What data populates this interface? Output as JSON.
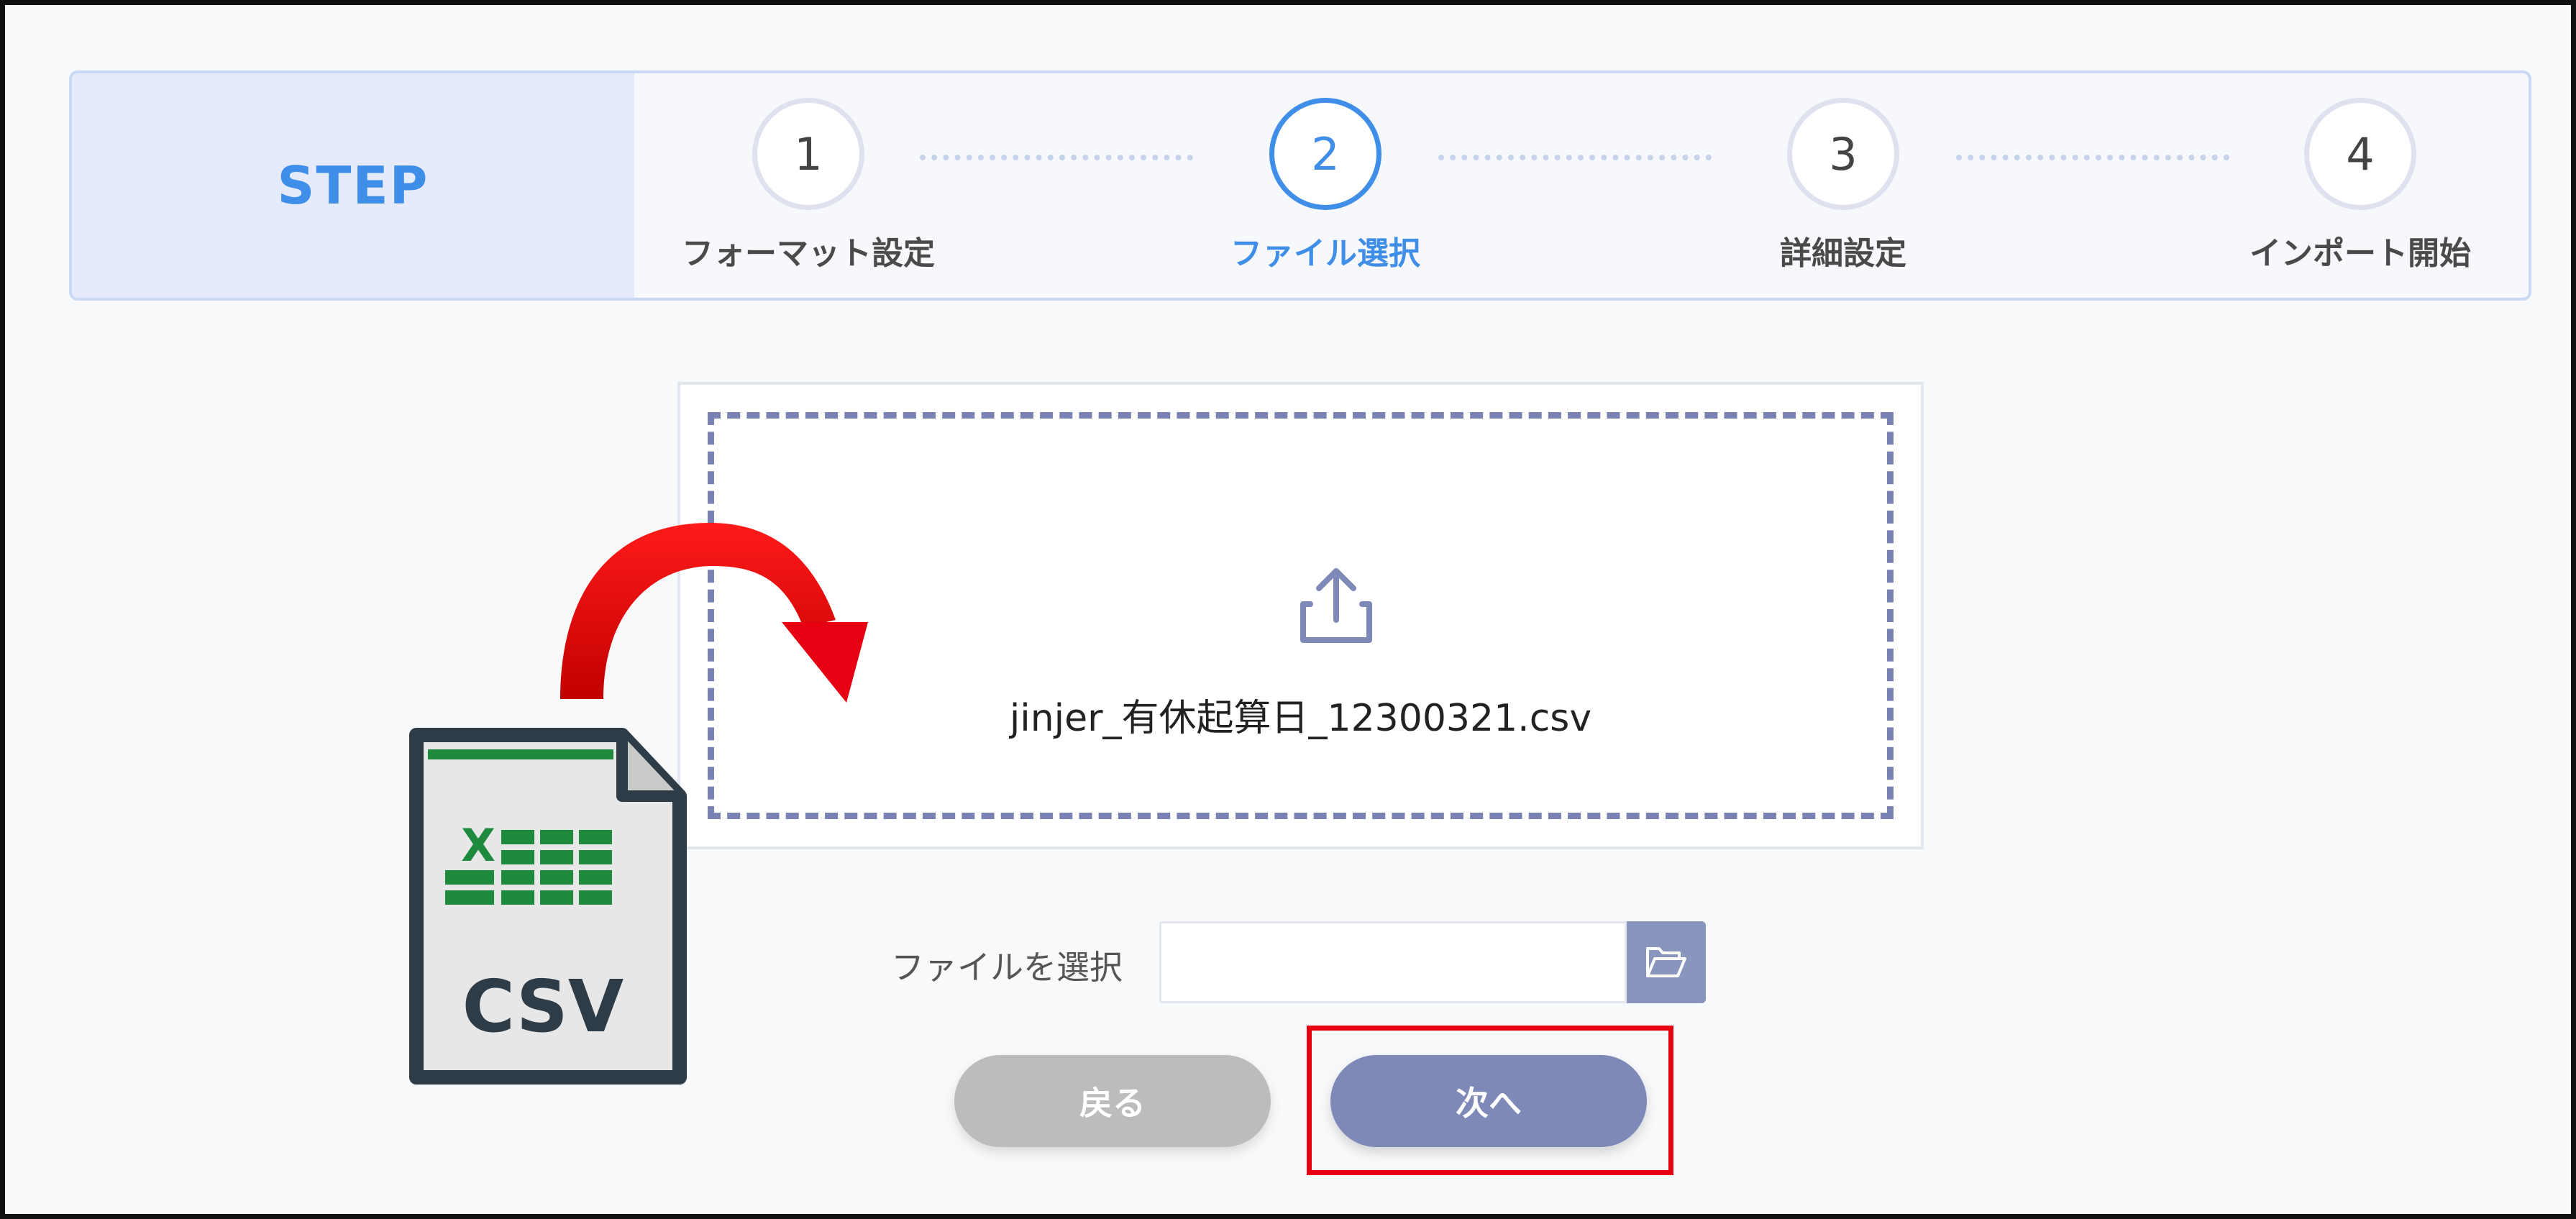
{
  "stepper": {
    "title": "STEP",
    "steps": [
      {
        "number": "1",
        "label": "フォーマット設定",
        "active": false
      },
      {
        "number": "2",
        "label": "ファイル選択",
        "active": true
      },
      {
        "number": "3",
        "label": "詳細設定",
        "active": false
      },
      {
        "number": "4",
        "label": "インポート開始",
        "active": false
      }
    ]
  },
  "dropzone": {
    "icon": "upload-icon",
    "file_name": "jinjer_有休起算日_12300321.csv"
  },
  "file_select": {
    "label": "ファイルを選択",
    "value": "",
    "button_icon": "folder-open-icon"
  },
  "buttons": {
    "back_label": "戻る",
    "next_label": "次へ"
  },
  "illustration": {
    "file_icon_text": "CSV",
    "file_icon_badge": "X",
    "arrow_color": "#e60012",
    "highlight_color": "#e60012"
  },
  "colors": {
    "accent": "#3f8ee8",
    "button_primary": "#7f89b8",
    "button_secondary": "#bcbcbc"
  }
}
